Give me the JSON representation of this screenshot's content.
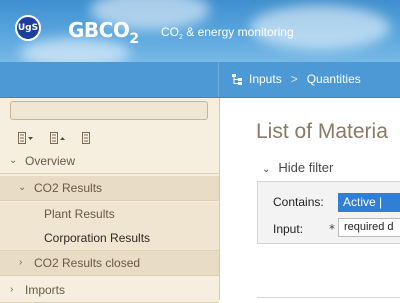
{
  "header": {
    "logo_text": "UgS",
    "brand_main": "GBCO",
    "brand_sub": "2",
    "tagline_prefix": "CO",
    "tagline_sub": "2",
    "tagline_rest": " & energy monitoring"
  },
  "breadcrumb": {
    "items": [
      "Inputs",
      "Quantities"
    ],
    "separator": ">"
  },
  "sidebar": {
    "search": {
      "value": "",
      "placeholder": ""
    },
    "toolbar_icons": [
      "expand-all-icon",
      "collapse-all-icon",
      "document-icon"
    ],
    "items": [
      {
        "label": "Overview",
        "chevron": "expanded"
      },
      {
        "label": "CO2 Results",
        "chevron": "expanded"
      },
      {
        "label": "Plant Results"
      },
      {
        "label": "Corporation Results"
      },
      {
        "label": "CO2 Results closed",
        "chevron": "collapsed"
      },
      {
        "label": "Imports",
        "chevron": "collapsed"
      }
    ]
  },
  "main": {
    "title": "List of Materia",
    "filter_toggle": "Hide filter",
    "filter": {
      "contains_label": "Contains:",
      "contains_value": "Active |",
      "input_label": "Input:",
      "required_mark": "*",
      "input_value": "required d"
    }
  },
  "colors": {
    "header_blue": "#4d99d6",
    "sidebar_bg": "#f6efe0",
    "selected_blue": "#2f7fd6",
    "title_color": "#8a7a66"
  }
}
